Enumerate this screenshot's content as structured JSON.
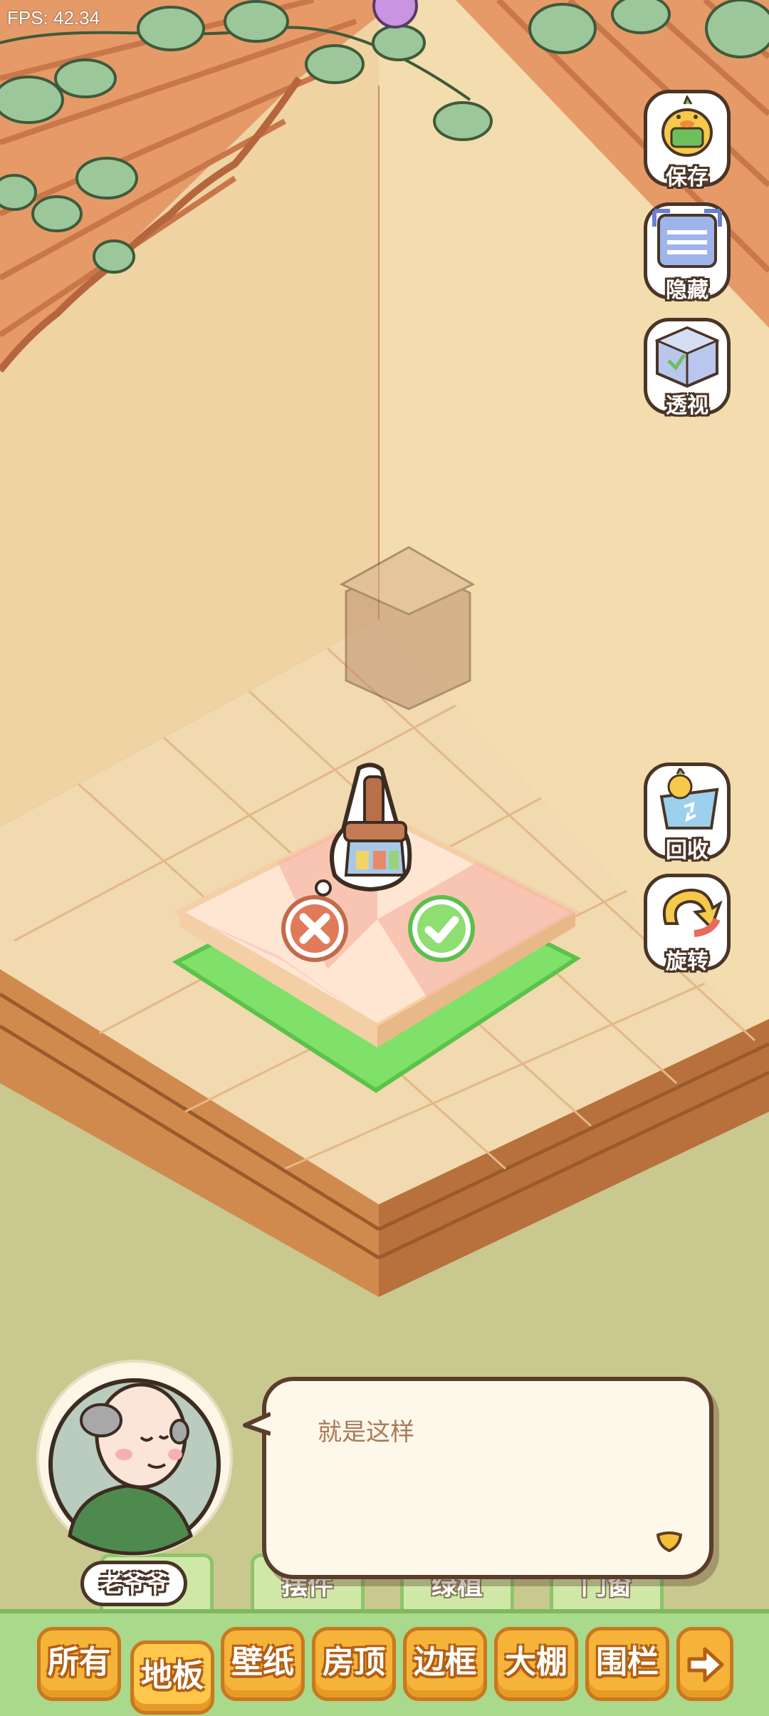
{
  "hud": {
    "fps": "FPS: 42.34"
  },
  "side_buttons": [
    {
      "label": "保存",
      "icon": "save-duck-icon"
    },
    {
      "label": "隐藏",
      "icon": "hide-frame-icon"
    },
    {
      "label": "透视",
      "icon": "perspective-cube-icon"
    },
    {
      "label": "回收",
      "icon": "recycle-bin-icon"
    },
    {
      "label": "旋转",
      "icon": "rotate-arrow-icon"
    }
  ],
  "placement": {
    "cancel_icon": "cancel-x-icon",
    "confirm_icon": "confirm-check-icon",
    "item_icon": "broom-brush-icon"
  },
  "dialog": {
    "speaker": "老爷爷",
    "text": "就是这样"
  },
  "under_tabs": [
    "摆件",
    "绿植",
    "门窗"
  ],
  "tabs": [
    {
      "label": "所有",
      "active": false
    },
    {
      "label": "地板",
      "active": true
    },
    {
      "label": "壁纸",
      "active": false
    },
    {
      "label": "房顶",
      "active": false
    },
    {
      "label": "边框",
      "active": false
    },
    {
      "label": "大棚",
      "active": false
    },
    {
      "label": "围栏",
      "active": false
    }
  ],
  "tab_more_icon": "arrow-right-icon",
  "colors": {
    "tab": "#f6b33a",
    "tab_border": "#c9781f",
    "bar": "#a9d98b",
    "valid_tile": "#7fe06a",
    "wall": "#f0d3a2"
  }
}
